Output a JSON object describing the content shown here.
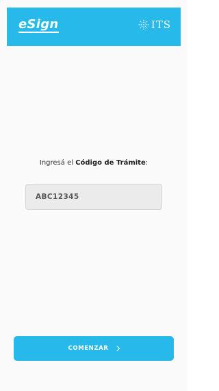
{
  "header": {
    "logo_text": "eSign",
    "brand_text": "ITS"
  },
  "main": {
    "prompt_prefix": "Ingresá el ",
    "prompt_bold": "Código de Trámite",
    "prompt_suffix": ":",
    "code_value": "ABC12345"
  },
  "footer": {
    "start_label": "COMENZAR"
  },
  "colors": {
    "accent": "#26b9ea",
    "field_bg": "#ebebeb"
  },
  "icons": {
    "brand_mark": "snowflake-grid-icon",
    "start_arrow": "chevron-right-icon"
  }
}
